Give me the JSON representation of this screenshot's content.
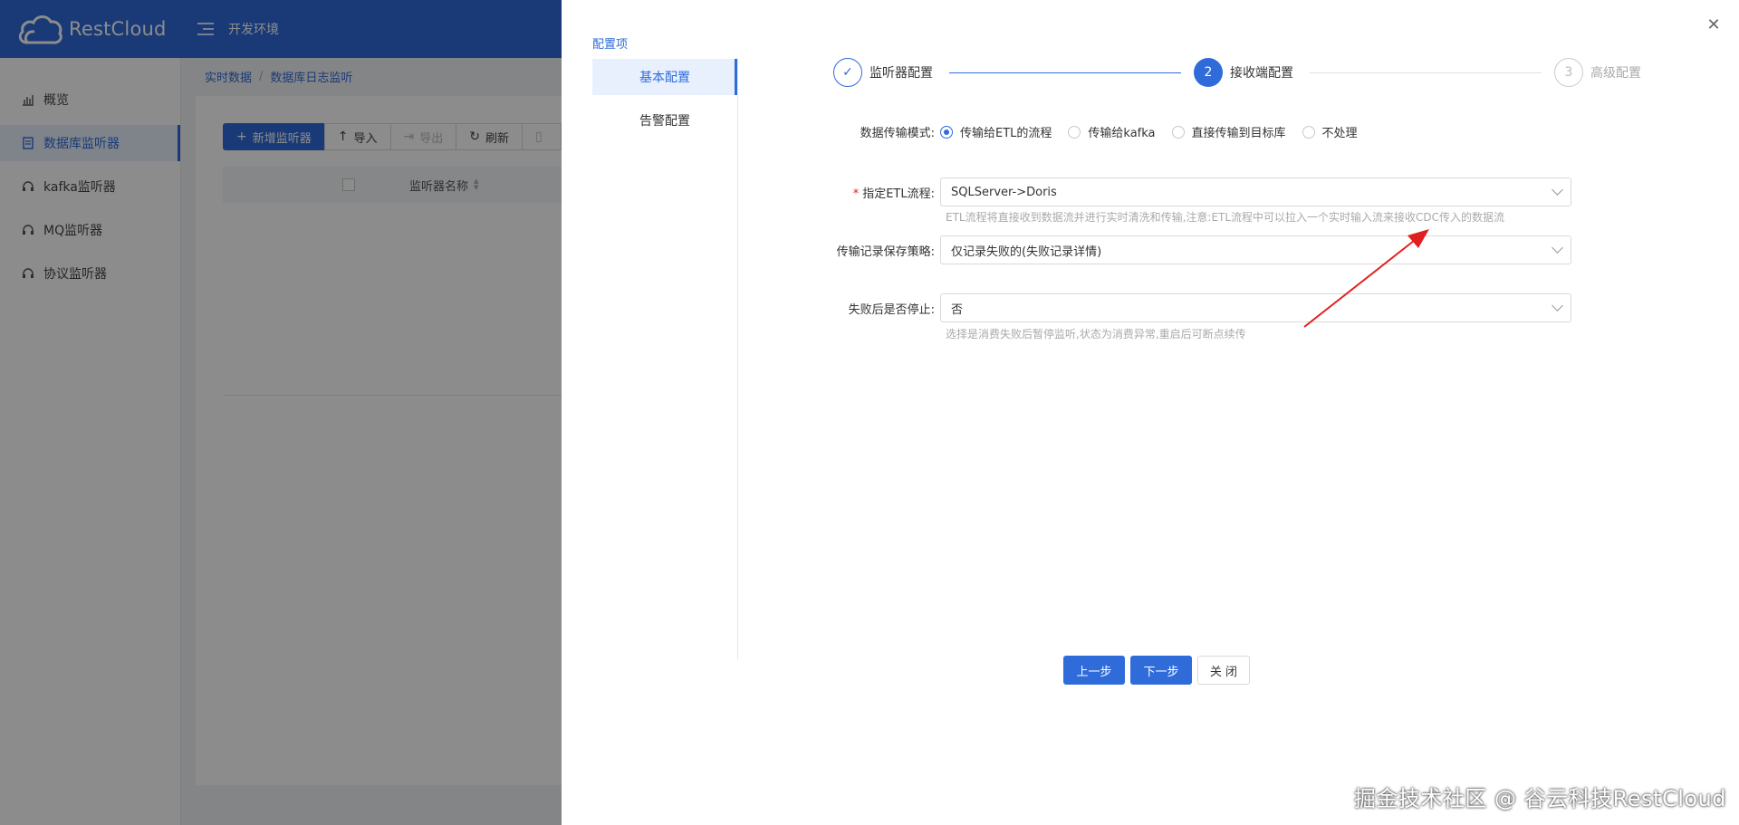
{
  "brand": {
    "name": "RestCloud"
  },
  "topbar": {
    "env": "开发环境"
  },
  "sidebar": {
    "items": [
      {
        "label": "概览",
        "icon": "bar-chart-icon"
      },
      {
        "label": "数据库监听器",
        "icon": "database-icon",
        "active": true
      },
      {
        "label": "kafka监听器",
        "icon": "headset-icon"
      },
      {
        "label": "MQ监听器",
        "icon": "headset-icon"
      },
      {
        "label": "协议监听器",
        "icon": "headset-icon"
      }
    ]
  },
  "breadcrumb": {
    "root": "实时数据",
    "sep": "/",
    "current": "数据库日志监听"
  },
  "toolbar": {
    "add": "新增监听器",
    "import": "导入",
    "export": "导出",
    "refresh": "刷新"
  },
  "table": {
    "col_name": "监听器名称"
  },
  "drawer": {
    "section_title": "配置项",
    "nav": [
      {
        "label": "基本配置",
        "active": true
      },
      {
        "label": "告警配置"
      }
    ],
    "close_icon": "close-icon",
    "steps": [
      {
        "num": "✓",
        "label": "监听器配置",
        "status": "done"
      },
      {
        "num": "2",
        "label": "接收端配置",
        "status": "current"
      },
      {
        "num": "3",
        "label": "高级配置",
        "status": "wait"
      }
    ],
    "form": {
      "mode_label": "数据传输模式:",
      "mode_options": [
        "传输给ETL的流程",
        "传输给kafka",
        "直接传输到目标库",
        "不处理"
      ],
      "mode_selected": 0,
      "etl_label": "指定ETL流程:",
      "etl_required": "*",
      "etl_value": "SQLServer->Doris",
      "etl_help": "ETL流程将直接收到数据流并进行实时清洗和传输,注意:ETL流程中可以拉入一个实时输入流来接收CDC传入的数据流",
      "policy_label": "传输记录保存策略:",
      "policy_value": "仅记录失败的(失败记录详情)",
      "stop_label": "失败后是否停止:",
      "stop_value": "否",
      "stop_help": "选择是消费失败后暂停监听,状态为消费异常,重启后可断点续传"
    },
    "buttons": {
      "prev": "上一步",
      "next": "下一步",
      "close": "关 闭"
    }
  },
  "watermark": "掘金技术社区 @ 谷云科技RestCloud",
  "colors": {
    "primary": "#2f6bd9",
    "annotation_arrow": "#e02020",
    "required": "#e02020"
  }
}
